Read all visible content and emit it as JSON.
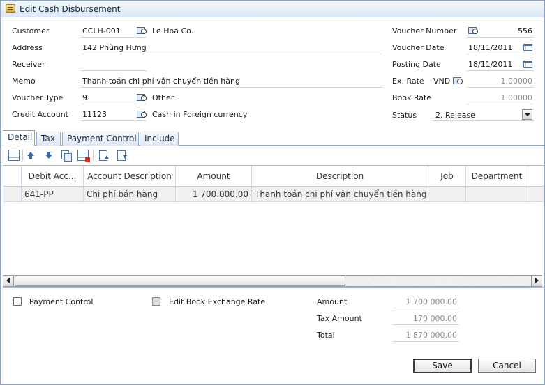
{
  "window": {
    "title": "Edit Cash Disbursement",
    "title_icon": "cash-voucher-icon"
  },
  "form": {
    "customer": {
      "label": "Customer",
      "code": "CCLH-001",
      "name": "Le Hoa Co."
    },
    "address": {
      "label": "Address",
      "value": "142 Phùng Hưng"
    },
    "receiver": {
      "label": "Receiver",
      "value": ""
    },
    "memo": {
      "label": "Memo",
      "value": "Thanh toán chi phí vận chuyển tiền hàng"
    },
    "voucher_type": {
      "label": "Voucher Type",
      "code": "9",
      "name": "Other"
    },
    "credit_account": {
      "label": "Credit Account",
      "code": "11123",
      "name": "Cash in Foreign currency"
    },
    "voucher_number": {
      "label": "Voucher Number",
      "value": "556"
    },
    "voucher_date": {
      "label": "Voucher Date",
      "value": "18/11/2011"
    },
    "posting_date": {
      "label": "Posting Date",
      "value": "18/11/2011"
    },
    "ex_rate": {
      "label": "Ex. Rate",
      "currency": "VND",
      "value": "1.00000"
    },
    "book_rate": {
      "label": "Book Rate",
      "value": "1.00000"
    },
    "status": {
      "label": "Status",
      "value": "2. Release"
    }
  },
  "tabs": [
    {
      "label": "Detail",
      "active": true
    },
    {
      "label": "Tax",
      "active": false
    },
    {
      "label": "Payment Control",
      "active": false
    },
    {
      "label": "Include",
      "active": false
    }
  ],
  "toolbar_icons": [
    "add-row-icon",
    "move-up-icon",
    "move-down-icon",
    "copy-icon",
    "delete-row-icon",
    "insert-above-icon",
    "insert-below-icon"
  ],
  "grid": {
    "columns": [
      "Debit Acc...",
      "Account Description",
      "Amount",
      "Description",
      "Job",
      "Department"
    ],
    "rows": [
      {
        "debit_acc": "641-PP",
        "account_description": "Chi phí bán hàng",
        "amount": "1 700 000.00",
        "description": "Thanh toán chi phí vận chuyển tiền hàng",
        "job": "",
        "department": ""
      }
    ]
  },
  "footer": {
    "payment_control": {
      "label": "Payment Control",
      "checked": false
    },
    "edit_book_rate": {
      "label": "Edit Book Exchange Rate",
      "checked": false
    },
    "amount": {
      "label": "Amount",
      "value": "1 700 000.00"
    },
    "tax_amount": {
      "label": "Tax Amount",
      "value": "170 000.00"
    },
    "total": {
      "label": "Total",
      "value": "1 870 000.00"
    }
  },
  "buttons": {
    "save": "Save",
    "cancel": "Cancel"
  }
}
